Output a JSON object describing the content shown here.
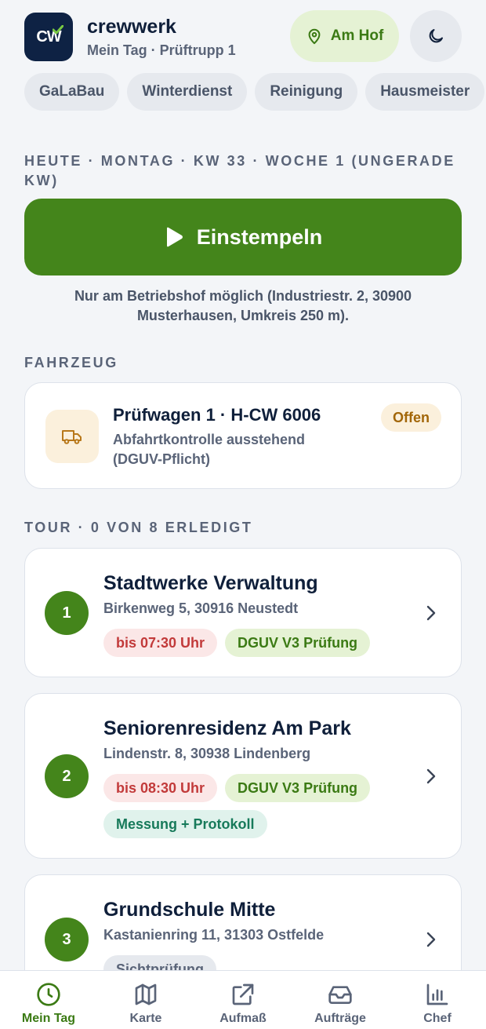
{
  "header": {
    "logo_text": "CW",
    "brand": "crewwerk",
    "subtitle": "Mein Tag · Prüftrupp 1",
    "location_label": "Am Hof",
    "theme_icon": "moon-icon"
  },
  "categories": [
    "GaLaBau",
    "Winterdienst",
    "Reinigung",
    "Hausmeister"
  ],
  "today_label": "HEUTE · MONTAG · KW 33 · WOCHE 1 (UNGERADE KW)",
  "clockin": {
    "label": "Einstempeln",
    "note": "Nur am Betriebshof möglich (Industriestr. 2, 30900 Musterhausen, Umkreis 250 m)."
  },
  "vehicle": {
    "section_label": "FAHRZEUG",
    "title": "Prüfwagen 1 · H-CW 6006",
    "description": "Abfahrtkontrolle ausstehend (DGUV-Pflicht)",
    "status": "Offen",
    "icon": "truck-icon"
  },
  "tour": {
    "section_label": "TOUR · 0 VON 8 ERLEDIGT",
    "stops": [
      {
        "number": "1",
        "name": "Stadtwerke Verwaltung",
        "address": "Birkenweg 5, 30916 Neustedt",
        "tags": [
          {
            "label": "bis 07:30 Uhr",
            "kind": "red"
          },
          {
            "label": "DGUV V3 Prüfung",
            "kind": "green"
          }
        ]
      },
      {
        "number": "2",
        "name": "Seniorenresidenz Am Park",
        "address": "Lindenstr. 8, 30938 Lindenberg",
        "tags": [
          {
            "label": "bis 08:30 Uhr",
            "kind": "red"
          },
          {
            "label": "DGUV V3 Prüfung",
            "kind": "green"
          },
          {
            "label": "Messung + Protokoll",
            "kind": "teal"
          }
        ]
      },
      {
        "number": "3",
        "name": "Grundschule Mitte",
        "address": "Kastanienring 11, 31303 Ostfelde",
        "tags": [
          {
            "label": "Sichtprüfung",
            "kind": "grey"
          }
        ]
      }
    ]
  },
  "nav": {
    "items": [
      {
        "label": "Mein Tag",
        "icon": "clock-icon",
        "active": true
      },
      {
        "label": "Karte",
        "icon": "map-icon",
        "active": false
      },
      {
        "label": "Aufmaß",
        "icon": "external-edit-icon",
        "active": false
      },
      {
        "label": "Aufträge",
        "icon": "inbox-icon",
        "active": false
      },
      {
        "label": "Chef",
        "icon": "bar-chart-icon",
        "active": false
      }
    ]
  },
  "colors": {
    "primary_green": "#44851b",
    "navy": "#0e2244",
    "background": "#f3f5f8"
  }
}
